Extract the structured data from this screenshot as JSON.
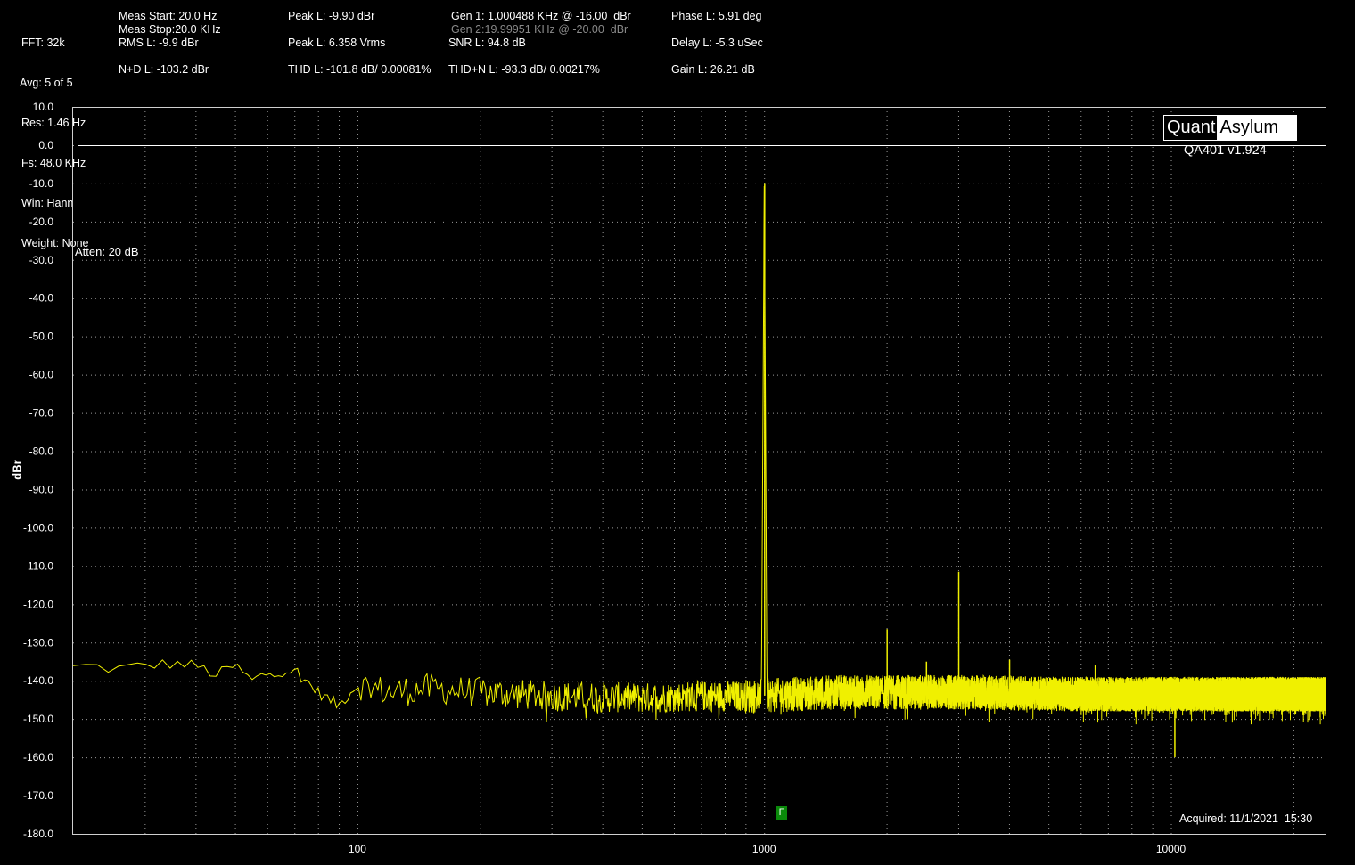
{
  "stats": {
    "col1": [
      "FFT: 32k",
      "Avg: 5 of 5",
      "Res: 1.46 Hz",
      "Fs: 48.0 KHz",
      "Win: Hann",
      "Weight: None"
    ],
    "meas_start": "Meas Start: 20.0 Hz",
    "meas_stop": "Meas Stop:20.0 KHz",
    "rms": "RMS L: -9.9 dBr",
    "nd": "N+D L: -103.2 dBr",
    "peak_dbr": "Peak L: -9.90 dBr",
    "peak_vrms": "Peak L: 6.358 Vrms",
    "thd": "THD L: -101.8 dB/ 0.00081%",
    "gen1": "Gen 1: 1.000488 KHz @ -16.00  dBr",
    "gen2": "Gen 2:19.99951 KHz @ -20.00  dBr",
    "snr": "SNR L: 94.8 dB",
    "thdn": "THD+N L: -93.3 dB/ 0.00217%",
    "phase": "Phase L: 5.91 deg",
    "delay": "Delay L: -5.3 uSec",
    "gain": "Gain L: 26.21 dB"
  },
  "logo": {
    "part1": "Quant",
    "part2": "Asylum"
  },
  "version": "QA401 v1.924",
  "atten": "Atten: 20 dB",
  "acquired": "Acquired: 11/1/2021  15:30",
  "marker": "F",
  "colors": {
    "trace": "#f0f000",
    "grid": "#9a9a9a",
    "reference": "#ffffff",
    "marker": "#0a8a0a"
  },
  "chart_data": {
    "type": "line",
    "xscale": "log",
    "xlim": [
      20,
      24000
    ],
    "ylim": [
      -180,
      10
    ],
    "ylabel": "dBr",
    "xticks": [
      100,
      1000,
      10000
    ],
    "xtick_labels": [
      "100",
      "1000",
      "10000"
    ],
    "yticks": [
      10,
      0,
      -10,
      -20,
      -30,
      -40,
      -50,
      -60,
      -70,
      -80,
      -90,
      -100,
      -110,
      -120,
      -130,
      -140,
      -150,
      -160,
      -170,
      -180
    ],
    "ytick_labels": [
      "10.0",
      "0.0",
      "-10.0",
      "-20.0",
      "-30.0",
      "-40.0",
      "-50.0",
      "-60.0",
      "-70.0",
      "-80.0",
      "-90.0",
      "-100.0",
      "-110.0",
      "-120.0",
      "-130.0",
      "-140.0",
      "-150.0",
      "-160.0",
      "-170.0",
      "-180.0"
    ],
    "reference_line_db": 0,
    "grid": true,
    "noise_floor_points": [
      [
        20,
        -136.5
      ],
      [
        22,
        -136
      ],
      [
        25,
        -137
      ],
      [
        30,
        -136
      ],
      [
        35,
        -135.5
      ],
      [
        40,
        -136
      ],
      [
        45,
        -138.5
      ],
      [
        50,
        -136
      ],
      [
        55,
        -140
      ],
      [
        60,
        -138
      ],
      [
        70,
        -137
      ],
      [
        80,
        -143
      ],
      [
        90,
        -146.5
      ],
      [
        100,
        -141
      ],
      [
        120,
        -143
      ],
      [
        150,
        -142
      ],
      [
        200,
        -143
      ],
      [
        300,
        -144
      ],
      [
        500,
        -144.5
      ],
      [
        700,
        -144
      ],
      [
        950,
        -144
      ],
      [
        1500,
        -143
      ],
      [
        3000,
        -143
      ],
      [
        6000,
        -143.5
      ],
      [
        10000,
        -143.5
      ],
      [
        24000,
        -143.5
      ]
    ],
    "spurs": [
      {
        "x": 1000.488,
        "y": -9.9
      },
      {
        "x": 2001,
        "y": -126.5
      },
      {
        "x": 2500,
        "y": -135
      },
      {
        "x": 3001.5,
        "y": -111.5
      },
      {
        "x": 4002,
        "y": -134.5
      },
      {
        "x": 6500,
        "y": -136
      },
      {
        "x": 10200,
        "y": -160
      }
    ]
  }
}
